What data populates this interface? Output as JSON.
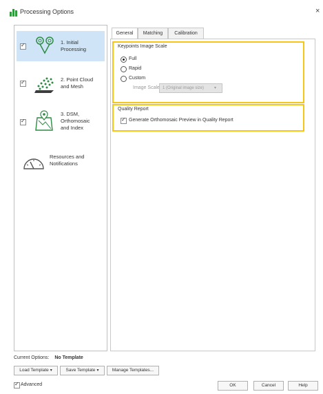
{
  "window": {
    "title": "Processing Options",
    "close_glyph": "×"
  },
  "sidebar": {
    "steps": [
      {
        "label": "1. Initial\nProcessing",
        "checked": true,
        "selected": true,
        "icon": "keypoints-icon"
      },
      {
        "label": "2. Point Cloud\nand Mesh",
        "checked": true,
        "selected": false,
        "icon": "point-cloud-icon"
      },
      {
        "label": "3. DSM,\nOrthomosaic\nand Index",
        "checked": true,
        "selected": false,
        "icon": "dsm-map-icon"
      },
      {
        "label": "Resources and\nNotifications",
        "checked": false,
        "selected": false,
        "icon": "gauge-icon"
      }
    ]
  },
  "tabs": [
    {
      "label": "General",
      "active": true
    },
    {
      "label": "Matching",
      "active": false
    },
    {
      "label": "Calibration",
      "active": false
    }
  ],
  "keypoints": {
    "title": "Keypoints Image Scale",
    "options": [
      {
        "label": "Full",
        "selected": true
      },
      {
        "label": "Rapid",
        "selected": false
      },
      {
        "label": "Custom",
        "selected": false
      }
    ],
    "image_scale_label": "Image Scale:",
    "image_scale_value": "1 (Original image size)",
    "image_scale_arrow": "▾"
  },
  "quality_report": {
    "title": "Quality Report",
    "checkbox_label": "Generate Orthomosaic Preview in Quality Report",
    "checked": true
  },
  "footer": {
    "current_options_label": "Current Options:",
    "current_options_value": "No Template",
    "load_template": "Load Template",
    "save_template": "Save Template",
    "manage_templates": "Manage Templates...",
    "dropdown_glyph": "▾",
    "advanced_label": "Advanced",
    "advanced_checked": true,
    "ok": "OK",
    "cancel": "Cancel",
    "help": "Help"
  },
  "colors": {
    "accent_highlight": "#f5c518",
    "selected_bg": "#cfe5f7",
    "icon_green": "#2e9e3c"
  }
}
